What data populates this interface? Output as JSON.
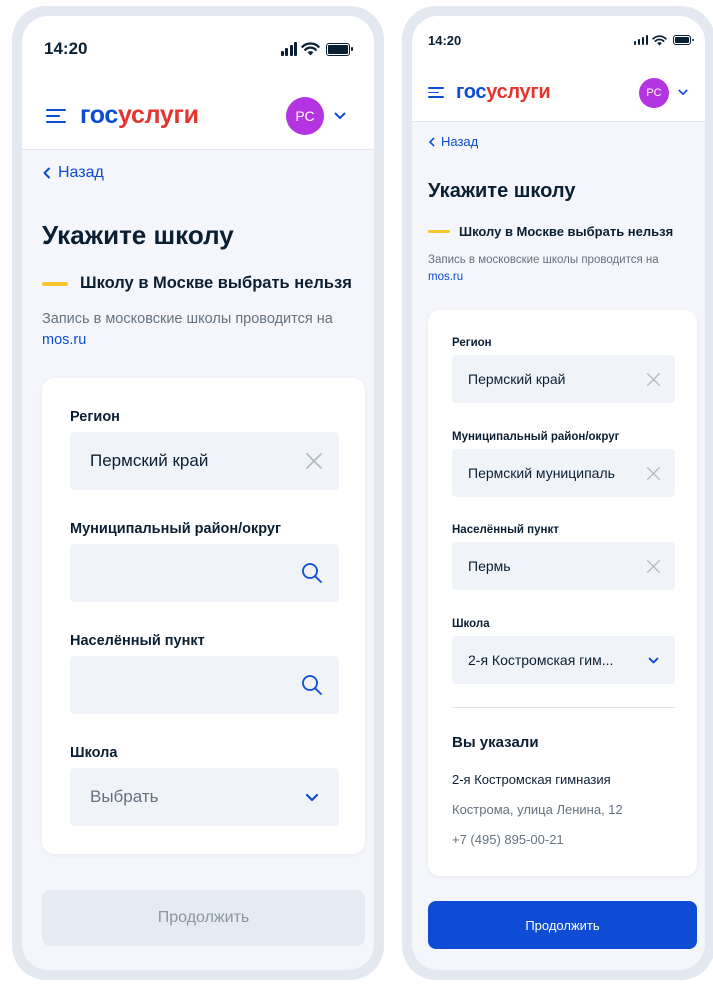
{
  "status": {
    "time": "14:20"
  },
  "header": {
    "logo_part1": "гос",
    "logo_part2": "услуги",
    "avatar_initials": "РС"
  },
  "back_label": "Назад",
  "page_title": "Укажите школу",
  "warning": {
    "title": "Школу в Москве выбрать нельзя",
    "text": "Запись в московские школы проводится на",
    "link": "mos.ru"
  },
  "form": {
    "region_label": "Регион",
    "district_label": "Муниципальный район/округ",
    "locality_label": "Населённый пункт",
    "school_label": "Школа",
    "school_placeholder": "Выбрать"
  },
  "screen1": {
    "region_value": "Пермский край",
    "district_value": "",
    "locality_value": "",
    "continue_label": "Продолжить"
  },
  "screen2": {
    "region_value": "Пермский край",
    "district_value": "Пермский муниципаль",
    "locality_value": "Пермь",
    "school_value": "2-я Костромская гим...",
    "summary_title": "Вы указали",
    "summary_name": "2-я Костромская гимназия",
    "summary_address": "Кострома, улица Ленина, 12",
    "summary_phone": "+7 (495) 895-00-21",
    "continue_label": "Продолжить"
  },
  "colors": {
    "brand_blue": "#0d4cd3",
    "brand_red": "#e5342f",
    "avatar": "#b334e0",
    "warning_bar": "#f7c62c"
  },
  "icons": [
    "burger-menu-icon",
    "chevron-down-icon",
    "chevron-left-icon",
    "clear-icon",
    "search-icon",
    "signal-icon",
    "wifi-icon",
    "battery-icon"
  ]
}
